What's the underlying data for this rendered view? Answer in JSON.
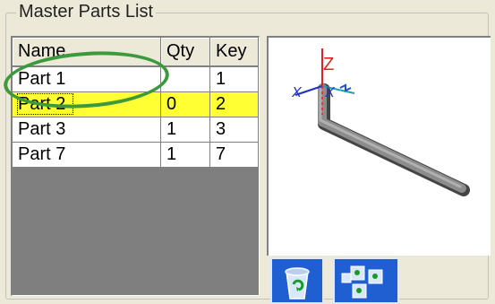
{
  "group": {
    "title": "Master Parts List"
  },
  "table": {
    "columns": [
      "Name",
      "Qty",
      "Key"
    ],
    "rows": [
      {
        "name": "Part 1",
        "qty": "",
        "key": "1",
        "selected": false
      },
      {
        "name": "Part 2",
        "qty": "0",
        "key": "2",
        "selected": true
      },
      {
        "name": "Part 3",
        "qty": "1",
        "key": "3",
        "selected": false
      },
      {
        "name": "Part 7",
        "qty": "1",
        "key": "7",
        "selected": false
      }
    ]
  },
  "preview": {
    "axis_labels": {
      "z": "Z",
      "x": "X",
      "y": "X"
    }
  },
  "toolbar": {
    "buttons": [
      {
        "icon": "recycle-bin-icon"
      },
      {
        "icon": "grid-view-icon"
      }
    ]
  },
  "colors": {
    "selected_row": "#ffff33",
    "highlight_ellipse": "#3c9a3c",
    "toolbar_button": "#1f5fd1"
  }
}
